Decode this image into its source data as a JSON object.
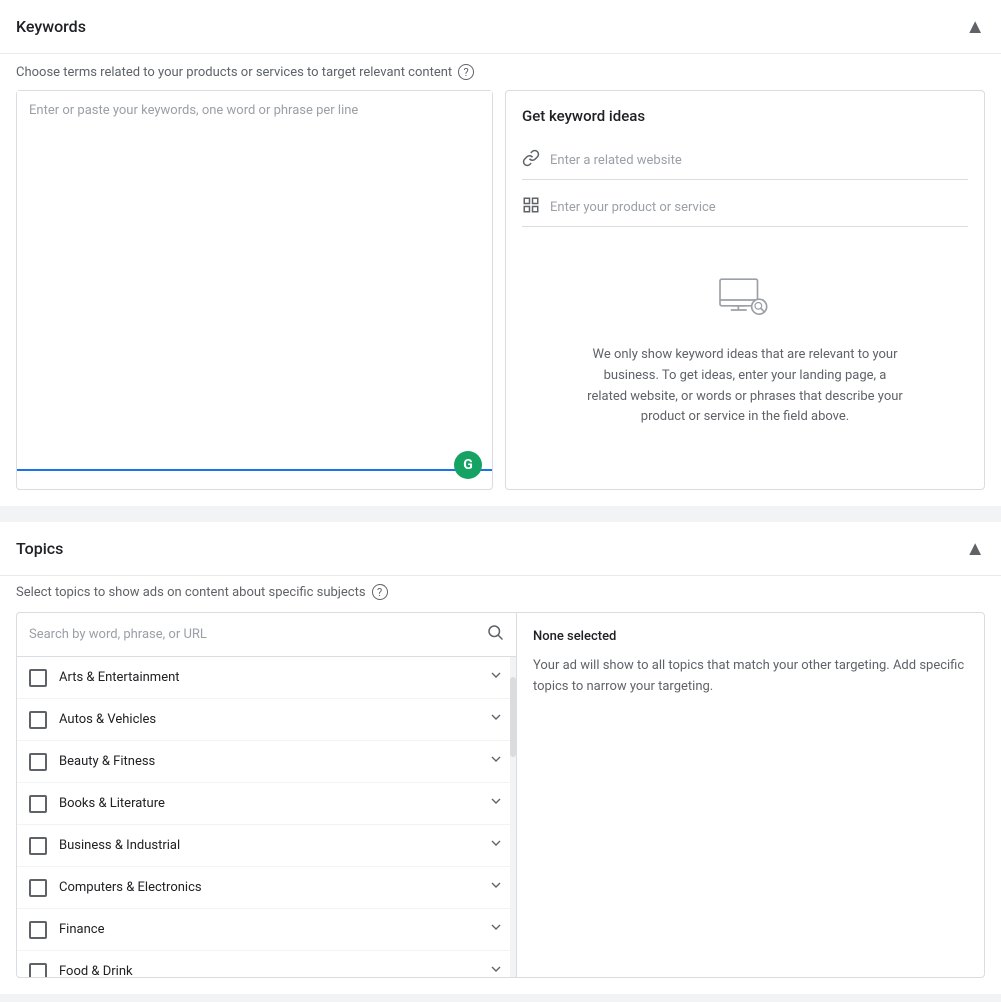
{
  "keywords_section": {
    "title": "Keywords",
    "subtitle": "Choose terms related to your products or services to target relevant content",
    "textarea_placeholder": "Enter or paste your keywords, one word or phrase per line",
    "get_ideas": {
      "title": "Get keyword ideas",
      "website_placeholder": "Enter a related website",
      "product_placeholder": "Enter your product or service",
      "description": "We only show keyword ideas that are relevant to your business. To get ideas, enter your landing page, a related website, or words or phrases that describe your product or service in the field above."
    }
  },
  "topics_section": {
    "title": "Topics",
    "subtitle": "Select topics to show ads on content about specific subjects",
    "search_placeholder": "Search by word, phrase, or URL",
    "topics": [
      "Arts & Entertainment",
      "Autos & Vehicles",
      "Beauty & Fitness",
      "Books & Literature",
      "Business & Industrial",
      "Computers & Electronics",
      "Finance",
      "Food & Drink"
    ],
    "none_selected_label": "None selected",
    "none_selected_text": "Your ad will show to all topics that match your other targeting. Add specific topics to narrow your targeting."
  },
  "icons": {
    "collapse": "▲",
    "expand": "▼",
    "help": "?",
    "search": "🔍",
    "link": "🔗",
    "grammarly": "G"
  }
}
